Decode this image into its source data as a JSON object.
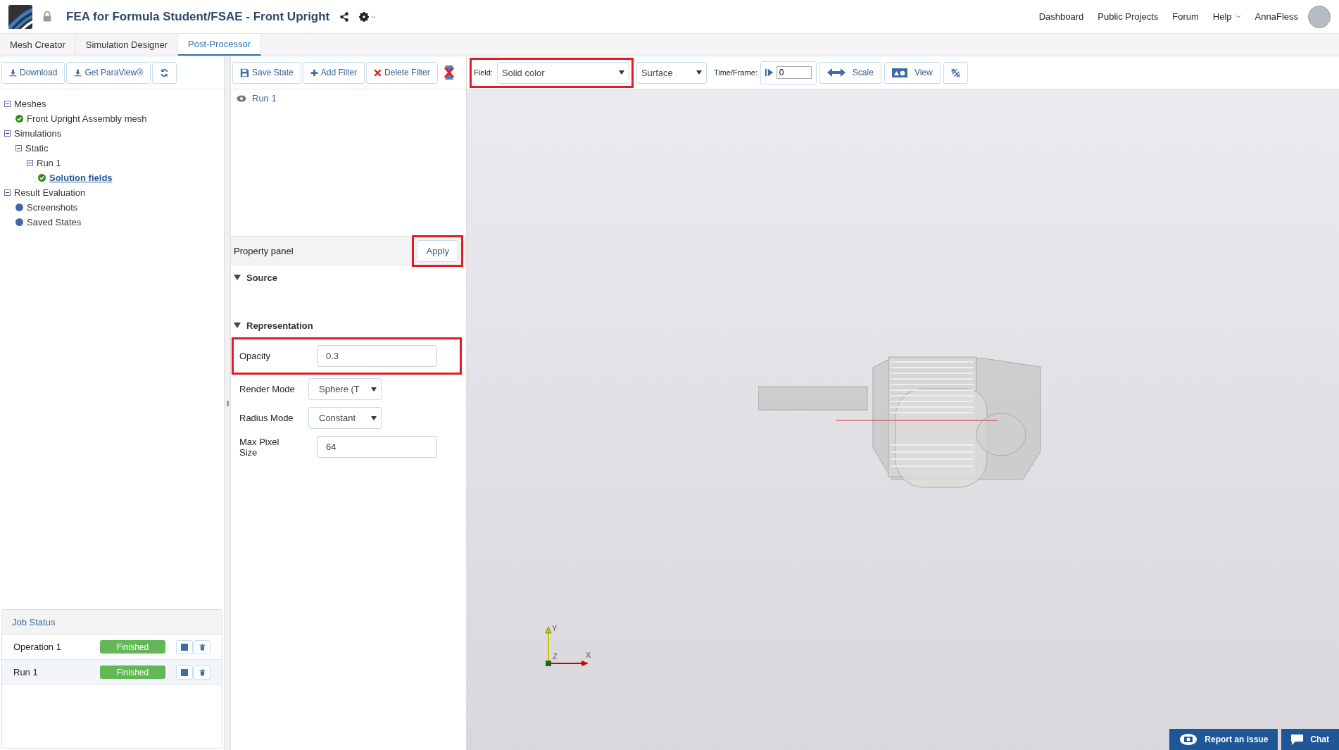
{
  "header": {
    "title": "FEA for Formula Student/FSAE - Front Upright",
    "nav": [
      {
        "label": "Dashboard",
        "dropdown": false
      },
      {
        "label": "Public Projects",
        "dropdown": false
      },
      {
        "label": "Forum",
        "dropdown": false
      },
      {
        "label": "Help",
        "dropdown": true
      }
    ],
    "user": "AnnaFless"
  },
  "steps": [
    {
      "label": "Mesh Creator",
      "selected": false
    },
    {
      "label": "Simulation Designer",
      "selected": false
    },
    {
      "label": "Post-Processor",
      "selected": true
    }
  ],
  "left_toolbar": [
    {
      "kind": "download",
      "label": "Download"
    },
    {
      "kind": "download",
      "label": "Get ParaView®"
    },
    {
      "kind": "refresh"
    }
  ],
  "tree": [
    {
      "label": "Meshes",
      "kind": "toggle",
      "expanded": true,
      "children": [
        {
          "label": "Front Upright Assembly mesh",
          "kind": "check",
          "link": false
        }
      ]
    },
    {
      "label": "Simulations",
      "kind": "toggle",
      "expanded": true,
      "children": [
        {
          "label": "Static",
          "kind": "toggle",
          "expanded": true,
          "children": [
            {
              "label": "Run 1",
              "kind": "toggle",
              "expanded": true,
              "children": [
                {
                  "label": "Solution fields",
                  "kind": "check",
                  "link": true
                }
              ]
            }
          ]
        }
      ]
    },
    {
      "label": "Result Evaluation",
      "kind": "toggle",
      "expanded": true,
      "children": [
        {
          "label": "Screenshots",
          "kind": "dot",
          "link": false
        },
        {
          "label": "Saved States",
          "kind": "dot",
          "link": false
        }
      ]
    }
  ],
  "job_status": {
    "title": "Job Status",
    "rows": [
      {
        "name": "Operation 1",
        "status": "Finished",
        "selected": false
      },
      {
        "name": "Run 1",
        "status": "Finished",
        "selected": true
      }
    ]
  },
  "filter_toolbar": [
    {
      "kind": "save",
      "label": "Save State"
    },
    {
      "kind": "add",
      "label": "Add Filter"
    },
    {
      "kind": "delete",
      "label": "Delete Filter"
    },
    {
      "kind": "paraview"
    }
  ],
  "view_toolbar": {
    "field_label": "Field:",
    "field": "Solid color",
    "field_highlighted": true,
    "representation": "Surface",
    "time_label": "Time/Frame:",
    "time_value": "0",
    "buttons": [
      {
        "kind": "scale",
        "label": "Scale"
      },
      {
        "kind": "view",
        "label": "View"
      },
      {
        "kind": "reset"
      }
    ]
  },
  "pipeline": [
    {
      "label": "Run 1",
      "visible": true
    }
  ],
  "property_panel": {
    "title": "Property panel",
    "apply": "Apply",
    "apply_highlighted": true,
    "sections": [
      {
        "title": "Source",
        "expanded": true
      },
      {
        "title": "Representation",
        "expanded": true,
        "fields": [
          {
            "label": "Opacity",
            "kind": "input",
            "value": "0.3",
            "highlighted": true
          },
          {
            "label": "Render Mode",
            "kind": "select",
            "value": "Sphere (T",
            "highlighted": false
          },
          {
            "label": "Radius Mode",
            "kind": "select",
            "value": "Constant",
            "highlighted": false
          },
          {
            "label": "Max Pixel Size",
            "kind": "input",
            "value": "64",
            "highlighted": false
          }
        ]
      }
    ]
  },
  "viewport": {
    "axes": {
      "y": "Y",
      "z": "Z",
      "x": "X"
    }
  },
  "bottom_buttons": [
    {
      "kind": "camera",
      "label": "Report an issue"
    },
    {
      "kind": "chat",
      "label": "Chat"
    }
  ]
}
